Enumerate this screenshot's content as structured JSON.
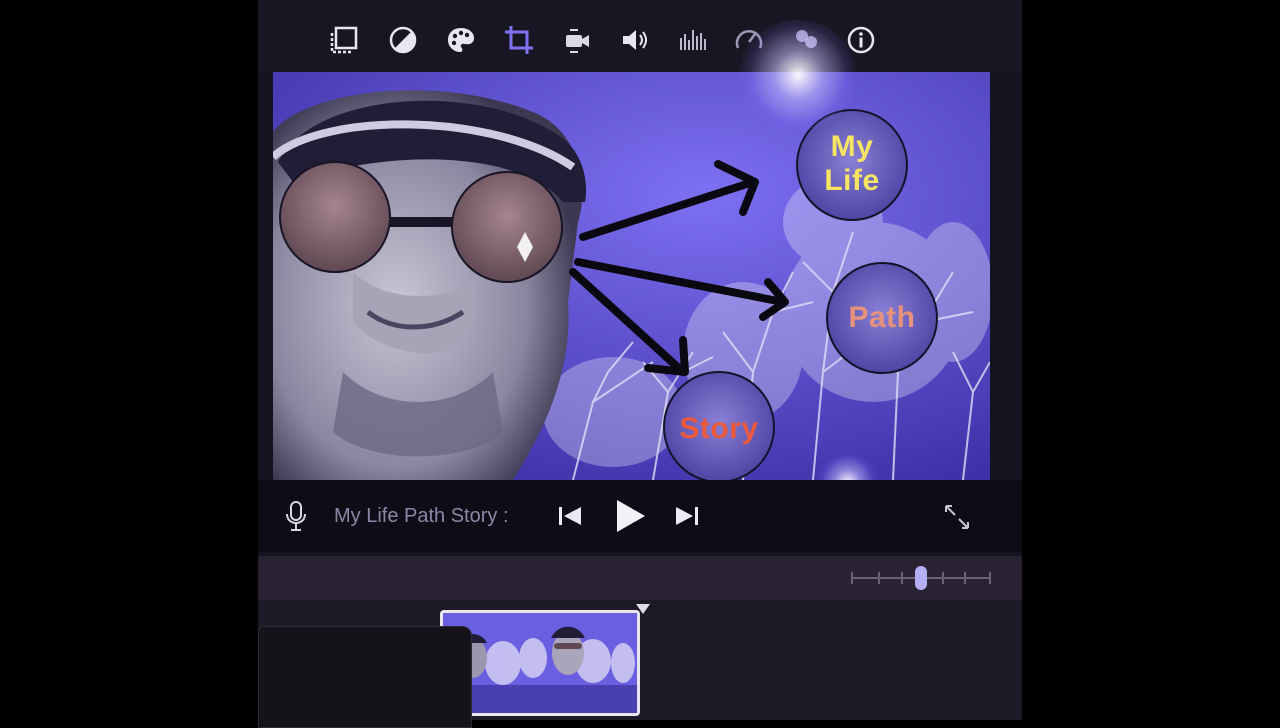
{
  "toolbar": {
    "tools": [
      {
        "icon": "overlay-icon"
      },
      {
        "icon": "filter-icon"
      },
      {
        "icon": "palette-icon"
      },
      {
        "icon": "crop-icon"
      },
      {
        "icon": "stabilize-icon"
      },
      {
        "icon": "volume-icon"
      },
      {
        "icon": "equalizer-icon"
      },
      {
        "icon": "speed-icon"
      },
      {
        "icon": "noise-icon"
      },
      {
        "icon": "info-icon"
      }
    ]
  },
  "viewer": {
    "bubbles": [
      {
        "label": "My\nLife",
        "color": "#f7e463"
      },
      {
        "label": "Path",
        "color": "#e7927a"
      },
      {
        "label": "Story",
        "color": "#ec5a3b"
      }
    ]
  },
  "controls": {
    "project_title": "My Life Path Story :",
    "icons": [
      "microphone-icon",
      "skip-back-icon",
      "play-icon",
      "skip-forward-icon",
      "fullscreen-icon"
    ]
  },
  "timeline": {
    "zoom_level": 0.5,
    "clip_count": 1
  },
  "colors": {
    "accent": "#6557dc",
    "background": "#000000",
    "panel": "#161320"
  }
}
